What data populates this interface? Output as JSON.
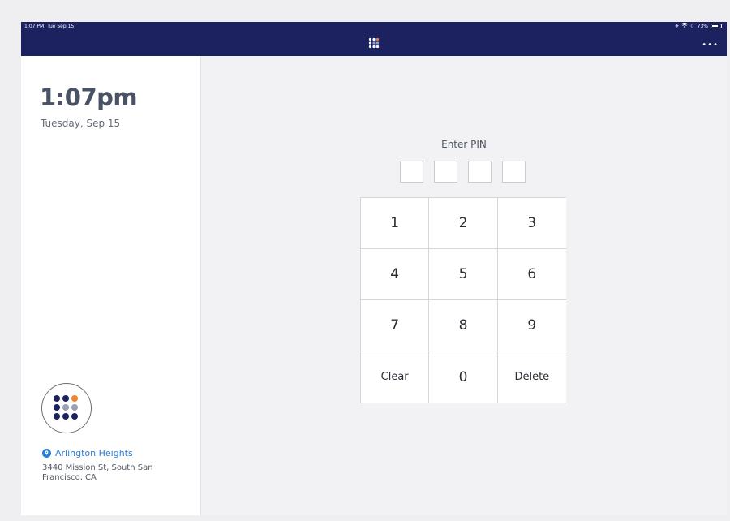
{
  "status_bar": {
    "time": "1:07 PM",
    "date": "Tue Sep 15",
    "battery": "73%",
    "battery_level": 0.73,
    "icons": [
      "airplane-icon",
      "wifi-icon",
      "moon-icon",
      "battery-icon"
    ]
  },
  "header": {
    "logo_icon": "dots-grid-icon",
    "more_label": "•••"
  },
  "sidebar": {
    "time": "1:07pm",
    "date": "Tuesday, Sep 15",
    "location_name": "Arlington Heights",
    "address": "3440 Mission St, South San Francisco, CA"
  },
  "pin": {
    "title": "Enter PIN",
    "digits_count": 4
  },
  "keypad": {
    "keys": [
      "1",
      "2",
      "3",
      "4",
      "5",
      "6",
      "7",
      "8",
      "9",
      "Clear",
      "0",
      "Delete"
    ]
  },
  "colors": {
    "header_bg": "#1c2260",
    "accent_blue": "#2b7fd4",
    "logo_navy": "#1c2260",
    "logo_orange": "#f0822a",
    "logo_grey": "#9aa0b2"
  }
}
